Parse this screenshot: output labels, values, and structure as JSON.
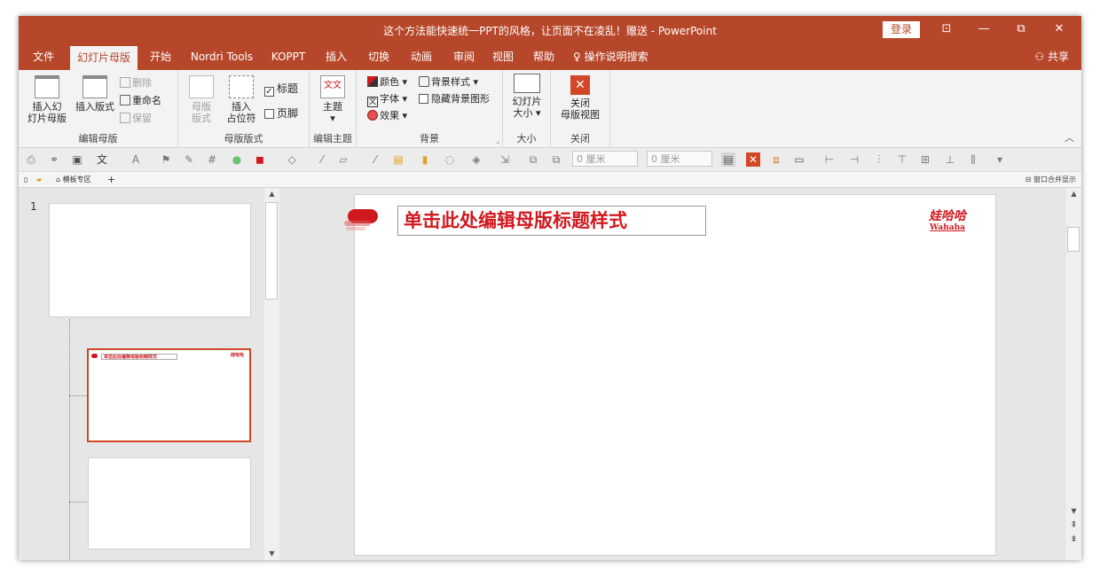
{
  "window": {
    "title": "这个方法能快速统一PPT的风格，让页面不在凌乱！赠送 - PowerPoint",
    "login": "登录",
    "controls": {
      "ribbon_display": "⊡",
      "minimize": "—",
      "restore": "⧉",
      "close": "✕"
    }
  },
  "tabs": [
    "文件",
    "幻灯片母版",
    "开始",
    "Nordri Tools",
    "KOPPT",
    "插入",
    "切换",
    "动画",
    "审阅",
    "视图",
    "帮助"
  ],
  "active_tab": "幻灯片母版",
  "tell_me": "操作说明搜索",
  "share": "共享",
  "ribbon": {
    "edit_master": {
      "label": "编辑母版",
      "insert_slide_master_l1": "插入幻",
      "insert_slide_master_l2": "灯片母版",
      "insert_layout": "插入版式",
      "delete": "删除",
      "rename": "重命名",
      "preserve": "保留"
    },
    "master_layout": {
      "label": "母版版式",
      "master_layout_l1": "母版",
      "master_layout_l2": "版式",
      "insert_placeholder_l1": "插入",
      "insert_placeholder_l2": "占位符",
      "title_check": "标题",
      "footer_check": "页脚"
    },
    "edit_theme": {
      "label": "编辑主题",
      "themes": "主题",
      "theme_glyph": "文文"
    },
    "background": {
      "label": "背景",
      "colors": "颜色",
      "fonts": "字体",
      "effects": "效果",
      "bg_styles": "背景样式",
      "hide_bg": "隐藏背景图形"
    },
    "size": {
      "label": "大小",
      "slide_size_l1": "幻灯片",
      "slide_size_l2": "大小"
    },
    "close": {
      "label": "关闭",
      "close_l1": "关闭",
      "close_l2": "母版视图"
    }
  },
  "toolbar2": {
    "width_value": "0 厘米",
    "height_value": "0 厘米"
  },
  "doc_tabs": {
    "template_area": "模板专区",
    "add": "+",
    "merge_windows": "窗口合并显示"
  },
  "thumbnails": {
    "slide_number": "1"
  },
  "slide": {
    "title_placeholder": "单击此处编辑母版标题样式",
    "logo_cn": "娃哈哈",
    "logo_en": "Wahaha"
  },
  "colors": {
    "accent": "#b7472a",
    "title_red": "#d0191f",
    "selection": "#d24726"
  }
}
